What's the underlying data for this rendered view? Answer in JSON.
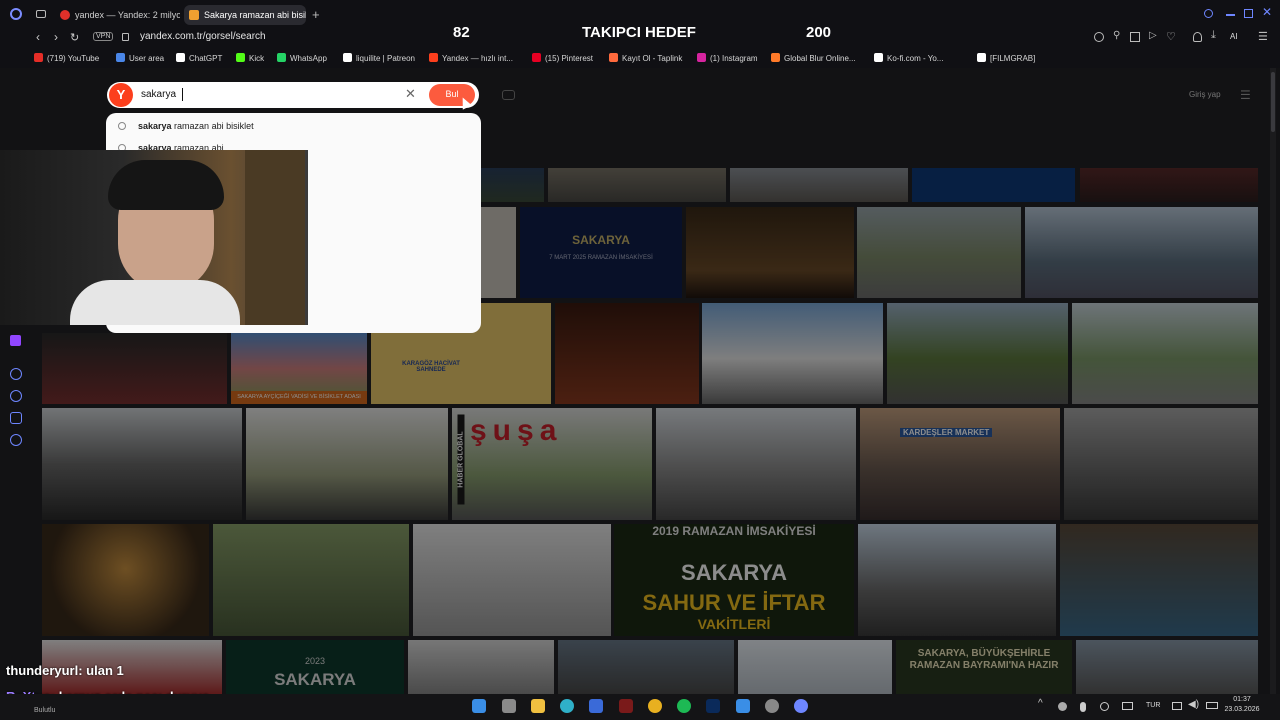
{
  "tabs": [
    {
      "title": "yandex — Yandex: 2 milyon",
      "active": false
    },
    {
      "title": "Sakarya ramazan abi bisikl",
      "active": true
    }
  ],
  "address": {
    "vpn": "VPN",
    "url": "yandex.com.tr/gorsel/search"
  },
  "bookmarks": [
    {
      "label": "(719) YouTube",
      "color": "#e52d27"
    },
    {
      "label": "User area",
      "color": "#4a86e8"
    },
    {
      "label": "ChatGPT",
      "color": "#ffffff"
    },
    {
      "label": "Kick",
      "color": "#53fc18"
    },
    {
      "label": "WhatsApp",
      "color": "#25d366"
    },
    {
      "label": "liquilite | Patreon",
      "color": "#ffffff"
    },
    {
      "label": "Yandex — hızlı int...",
      "color": "#fc3f1d"
    },
    {
      "label": "(15) Pinterest",
      "color": "#e60023"
    },
    {
      "label": "Kayıt Ol - Taplink",
      "color": "#ff6a3d"
    },
    {
      "label": "(1) Instagram",
      "color": "#d6249f"
    },
    {
      "label": "Global Blur Online...",
      "color": "#ff7a29"
    },
    {
      "label": "Ko-fi.com - Yo...",
      "color": "#ffffff"
    },
    {
      "label": "[FILMGRAB]",
      "color": "#ffffff"
    }
  ],
  "stream_overlay": {
    "followers": "82",
    "goal_label": "TAKIPCI HEDEF",
    "goal": "200"
  },
  "search": {
    "logo": "Y",
    "query": "sakarya ",
    "button": "Bul",
    "login": "Giriş yap"
  },
  "suggestions": [
    {
      "bold": "sakarya",
      "rest": " ramazan abi bisiklet"
    },
    {
      "bold": "sakarya",
      "rest": " ramazan abi"
    }
  ],
  "tiles": {
    "sakarya_title": "SAKARYA",
    "sakarya_sub": "7 MART 2025 RAMAZAN İMSAKİYESİ",
    "adasi": "SAKARYA AYÇİÇEĞİ VADİSİ VE BİSİKLET ADASI",
    "karagoz": "KARAGÖZ HACİVAT SAHNEDE",
    "susa": "şuşa",
    "haber": "HABER GLOBAL",
    "market": "KARDEŞLER MARKET",
    "imsakiye_1": "2019 RAMAZAN İMSAKİYESİ",
    "imsakiye_2": "SAKARYA",
    "imsakiye_3": "SAHUR VE İFTAR",
    "imsakiye_4": "VAKİTLERİ",
    "bottom_2023": "2023",
    "bottom_sakarya": "SAKARYA",
    "buyuksehir": "SAKARYA, BÜYÜKŞEHİRLE RAMAZAN BAYRAMI'NA HAZIR"
  },
  "chat": [
    {
      "user": "thunderyurl",
      "user_color": "#ffffff",
      "message": ": ulan 1"
    },
    {
      "user": "ReXtus",
      "user_color": "#9b7cff",
      "message": ": karpuz orda nası duruyo"
    }
  ],
  "taskbar": {
    "lang": "TUR",
    "time": "01:37",
    "date": "23.03.2026",
    "weather": "Bulutlu"
  }
}
